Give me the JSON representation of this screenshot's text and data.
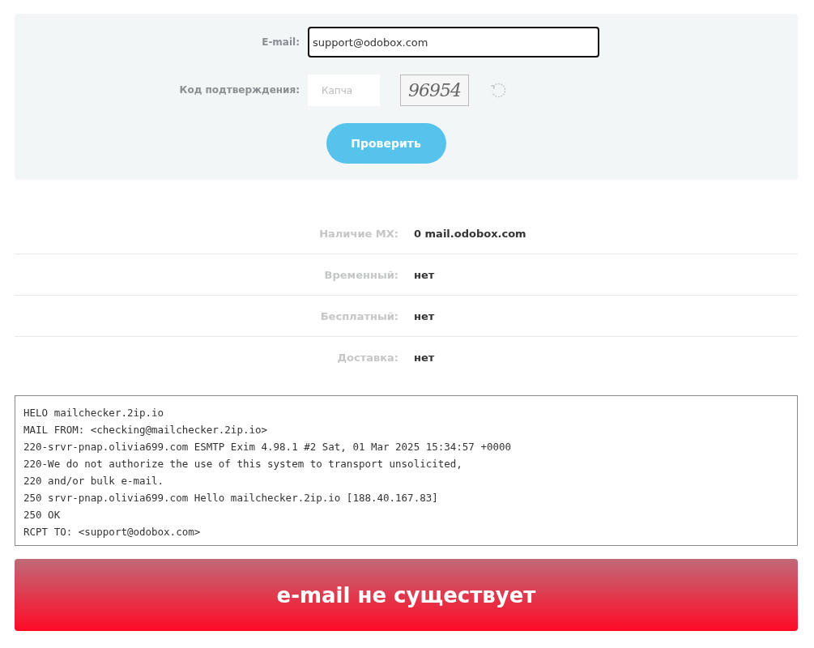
{
  "form": {
    "email_label": "E-mail:",
    "email_value": "support@odobox.com",
    "code_label": "Код подтверждения:",
    "captcha_placeholder": "Капча",
    "captcha_code": "96954",
    "submit": "Проверить"
  },
  "results": [
    {
      "label": "Наличие MX:",
      "value": "**0** mail.odobox.com"
    },
    {
      "label": "Временный:",
      "value": "нет"
    },
    {
      "label": "Бесплатный:",
      "value": "нет"
    },
    {
      "label": "Доставка:",
      "value": "нет"
    }
  ],
  "log": [
    "HELO mailchecker.2ip.io",
    "MAIL FROM: <checking@mailchecker.2ip.io>",
    "220-srvr-pnap.olivia699.com ESMTP Exim 4.98.1 #2 Sat, 01 Mar 2025 15:34:57 +0000",
    "220-We do not authorize the use of this system to transport unsolicited,",
    "220 and/or bulk e-mail.",
    "250 srvr-pnap.olivia699.com Hello mailchecker.2ip.io [188.40.167.83]",
    "250 OK",
    "RCPT TO: <support@odobox.com>"
  ],
  "verdict": {
    "text": "e-mail не существует",
    "kind": "error"
  }
}
